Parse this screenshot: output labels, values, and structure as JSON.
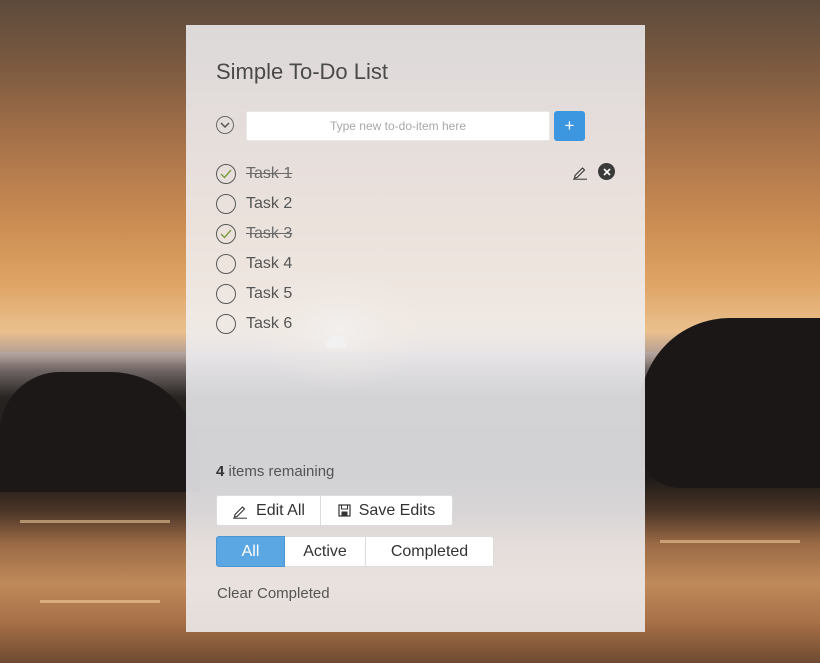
{
  "app": {
    "title": "Simple To-Do List"
  },
  "new_item": {
    "placeholder": "Type new to-do-item here",
    "value": "",
    "add_label": "+"
  },
  "todos": [
    {
      "label": "Task 1",
      "completed": true
    },
    {
      "label": "Task 2",
      "completed": false
    },
    {
      "label": "Task 3",
      "completed": true
    },
    {
      "label": "Task 4",
      "completed": false
    },
    {
      "label": "Task 5",
      "completed": false
    },
    {
      "label": "Task 6",
      "completed": false
    }
  ],
  "footer": {
    "remaining_count": "4",
    "remaining_text": " items remaining",
    "edit_all_label": "Edit All",
    "save_edits_label": "Save Edits",
    "filters": {
      "all": "All",
      "active": "Active",
      "completed": "Completed"
    },
    "selected_filter": "All",
    "clear_completed_label": "Clear Completed"
  },
  "icons": {
    "toggle_all": "chevron-down-icon",
    "item_check": "check-icon",
    "item_edit": "pencil-icon",
    "item_delete": "close-icon",
    "edit_all": "pencil-icon",
    "save_edits": "floppy-disk-icon"
  },
  "colors": {
    "accent": "#3d97e0",
    "selected_filter": "#5aa7e3"
  }
}
